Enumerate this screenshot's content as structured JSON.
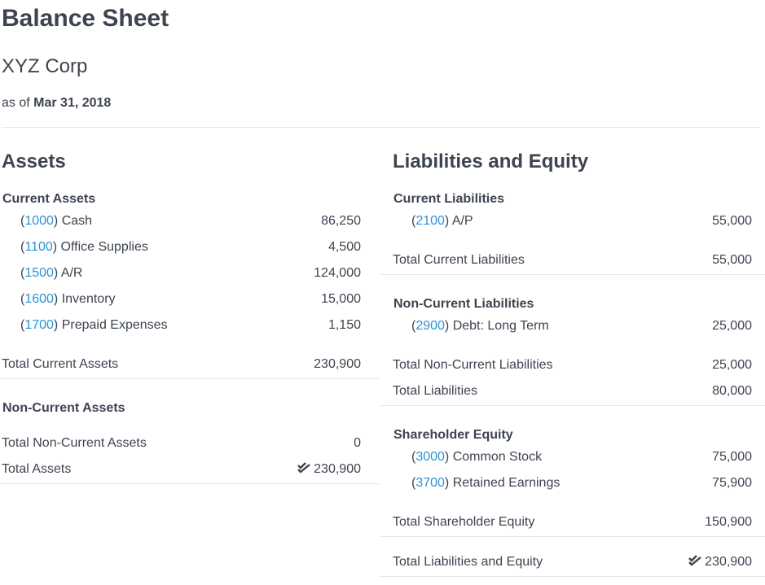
{
  "header": {
    "title": "Balance Sheet",
    "company": "XYZ Corp",
    "as_of_prefix": "as of",
    "as_of_date": "Mar 31, 2018"
  },
  "assets": {
    "heading": "Assets",
    "current": {
      "label": "Current Assets",
      "accounts": [
        {
          "code": "1000",
          "name": "Cash",
          "amount": "86,250"
        },
        {
          "code": "1100",
          "name": "Office Supplies",
          "amount": "4,500"
        },
        {
          "code": "1500",
          "name": "A/R",
          "amount": "124,000"
        },
        {
          "code": "1600",
          "name": "Inventory",
          "amount": "15,000"
        },
        {
          "code": "1700",
          "name": "Prepaid Expenses",
          "amount": "1,150"
        }
      ],
      "total_label": "Total Current Assets",
      "total_amount": "230,900"
    },
    "non_current": {
      "label": "Non-Current Assets",
      "total_label": "Total Non-Current Assets",
      "total_amount": "0"
    },
    "total_label": "Total Assets",
    "total_amount": "230,900",
    "check_icon": "double-check-icon"
  },
  "liabilities_equity": {
    "heading": "Liabilities and Equity",
    "current": {
      "label": "Current Liabilities",
      "accounts": [
        {
          "code": "2100",
          "name": "A/P",
          "amount": "55,000"
        }
      ],
      "total_label": "Total Current Liabilities",
      "total_amount": "55,000"
    },
    "non_current": {
      "label": "Non-Current Liabilities",
      "accounts": [
        {
          "code": "2900",
          "name": "Debt: Long Term",
          "amount": "25,000"
        }
      ],
      "total_label": "Total Non-Current Liabilities",
      "total_amount": "25,000"
    },
    "total_liabilities_label": "Total Liabilities",
    "total_liabilities_amount": "80,000",
    "equity": {
      "label": "Shareholder Equity",
      "accounts": [
        {
          "code": "3000",
          "name": "Common Stock",
          "amount": "75,000"
        },
        {
          "code": "3700",
          "name": "Retained Earnings",
          "amount": "75,900"
        }
      ],
      "total_label": "Total Shareholder Equity",
      "total_amount": "150,900"
    },
    "total_label": "Total Liabilities and Equity",
    "total_amount": "230,900"
  },
  "colors": {
    "text": "#3d4450",
    "link": "#2a93d5",
    "rule": "#e6e6e6"
  }
}
